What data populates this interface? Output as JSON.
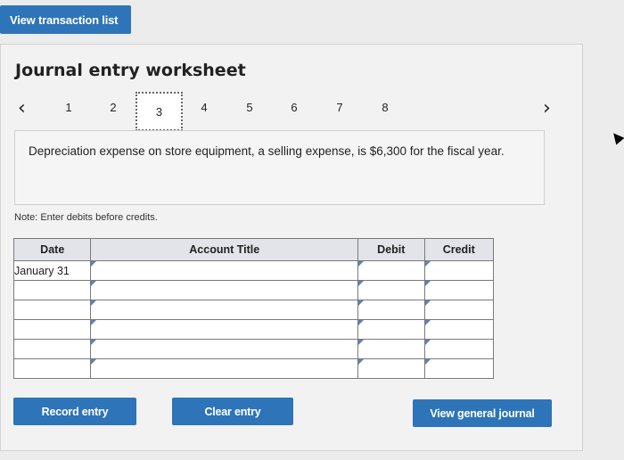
{
  "header": {
    "view_transaction_list": "View transaction list"
  },
  "worksheet": {
    "title": "Journal entry worksheet"
  },
  "pager": {
    "prev_icon": "chevron-left-icon",
    "next_icon": "chevron-right-icon",
    "pages": [
      "1",
      "2",
      "3",
      "4",
      "5",
      "6",
      "7",
      "8"
    ],
    "active": "3"
  },
  "description": "Depreciation expense on store equipment, a selling expense, is $6,300 for the fiscal year.",
  "note": "Note: Enter debits before credits.",
  "table": {
    "headers": {
      "date": "Date",
      "account": "Account Title",
      "debit": "Debit",
      "credit": "Credit"
    },
    "rows": [
      {
        "date": "January 31",
        "account": "",
        "debit": "",
        "credit": ""
      },
      {
        "date": "",
        "account": "",
        "debit": "",
        "credit": ""
      },
      {
        "date": "",
        "account": "",
        "debit": "",
        "credit": ""
      },
      {
        "date": "",
        "account": "",
        "debit": "",
        "credit": ""
      },
      {
        "date": "",
        "account": "",
        "debit": "",
        "credit": ""
      },
      {
        "date": "",
        "account": "",
        "debit": "",
        "credit": ""
      }
    ]
  },
  "buttons": {
    "record": "Record entry",
    "clear": "Clear entry",
    "view_general": "View general journal"
  },
  "colors": {
    "accent": "#2e74b8",
    "input_border": "#5b82b8"
  }
}
